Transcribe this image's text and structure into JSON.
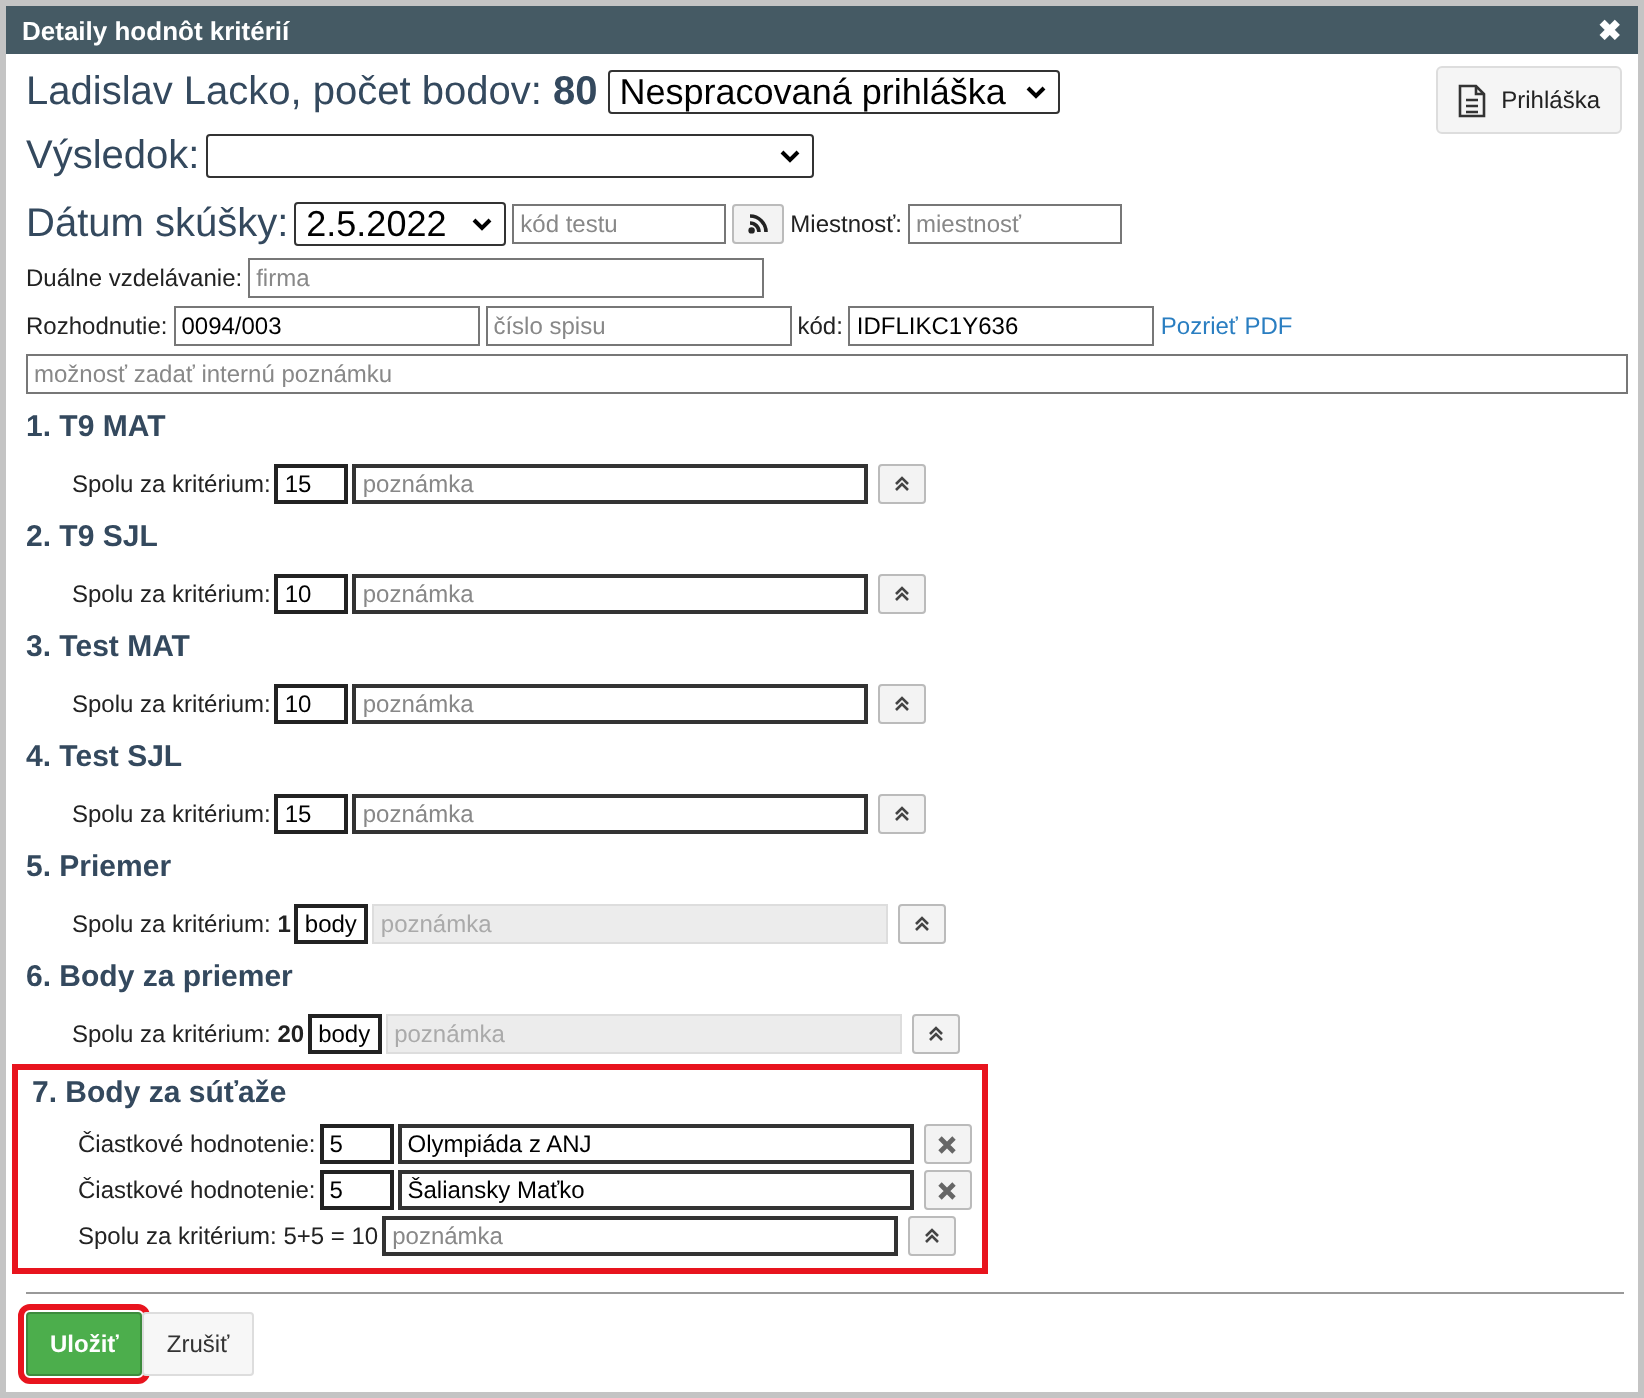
{
  "window": {
    "title": "Detaily hodnôt kritérií",
    "close": "✖"
  },
  "header": {
    "name": "Ladislav Lacko, počet bodov:",
    "points": "80",
    "status": "Nespracovaná prihláška",
    "application_button": "Prihláška"
  },
  "result": {
    "label": "Výsledok:"
  },
  "exam": {
    "label": "Dátum skúšky:",
    "date": "2.5.2022",
    "test_code_placeholder": "kód testu",
    "room_label": "Miestnosť:",
    "room_placeholder": "miestnosť"
  },
  "dual": {
    "label": "Duálne vzdelávanie:",
    "placeholder": "firma"
  },
  "decision": {
    "label": "Rozhodnutie:",
    "value": "0094/003",
    "file_placeholder": "číslo spisu",
    "code_label": "kód:",
    "code": "IDFLIKC1Y636",
    "pdf_link": "Pozrieť PDF"
  },
  "internal_note": {
    "placeholder": "možnosť zadať internú poznámku"
  },
  "criteria": [
    {
      "kind": "score",
      "title": "1. T9 MAT",
      "label": "Spolu za kritérium:",
      "value": "15",
      "note_placeholder": "poznámka",
      "highlighted": false
    },
    {
      "kind": "score",
      "title": "2. T9 SJL",
      "label": "Spolu za kritérium:",
      "value": "10",
      "note_placeholder": "poznámka",
      "highlighted": false
    },
    {
      "kind": "score",
      "title": "3. Test MAT",
      "label": "Spolu za kritérium:",
      "value": "10",
      "note_placeholder": "poznámka",
      "highlighted": false
    },
    {
      "kind": "score",
      "title": "4. Test SJL",
      "label": "Spolu za kritérium:",
      "value": "15",
      "note_placeholder": "poznámka",
      "highlighted": false
    },
    {
      "kind": "computed",
      "title": "5. Priemer",
      "label": "Spolu za kritérium:",
      "total": "1",
      "value": "body",
      "note_placeholder": "poznámka",
      "highlighted": false
    },
    {
      "kind": "computed",
      "title": "6. Body za priemer",
      "label": "Spolu za kritérium:",
      "total": "20",
      "value": "body",
      "note_placeholder": "poznámka",
      "highlighted": false
    },
    {
      "kind": "partial",
      "title": "7. Body za súťaže",
      "partials": [
        {
          "label": "Čiastkové hodnotenie:",
          "value": "5",
          "description": "Olympiáda z ANJ"
        },
        {
          "label": "Čiastkové hodnotenie:",
          "value": "5",
          "description": "Šaliansky Maťko"
        }
      ],
      "label": "Spolu za kritérium: 5+5 = 10",
      "note_placeholder": "poznámka",
      "highlighted": true
    }
  ],
  "buttons": [
    {
      "kind": "save",
      "label": "Uložiť",
      "highlighted": true
    },
    {
      "kind": "cancel",
      "label": "Zrušiť",
      "highlighted": false
    }
  ]
}
